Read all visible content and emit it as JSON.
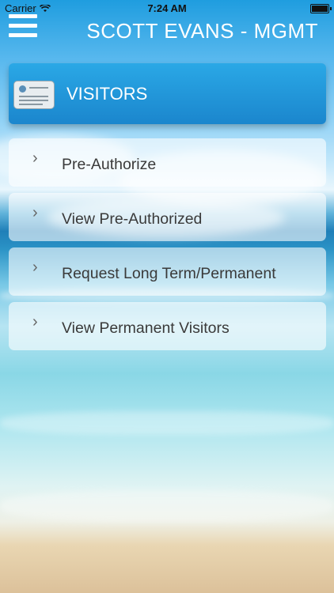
{
  "status_bar": {
    "carrier": "Carrier",
    "time": "7:24 AM"
  },
  "header": {
    "title": "SCOTT EVANS - MGMT",
    "menu_icon": "hamburger-icon"
  },
  "banner": {
    "label": "VISITORS",
    "icon": "id-card-icon"
  },
  "menu": {
    "items": [
      {
        "label": "Pre-Authorize"
      },
      {
        "label": "View Pre-Authorized"
      },
      {
        "label": "Request Long Term/Permanent"
      },
      {
        "label": "View Permanent Visitors"
      }
    ]
  }
}
